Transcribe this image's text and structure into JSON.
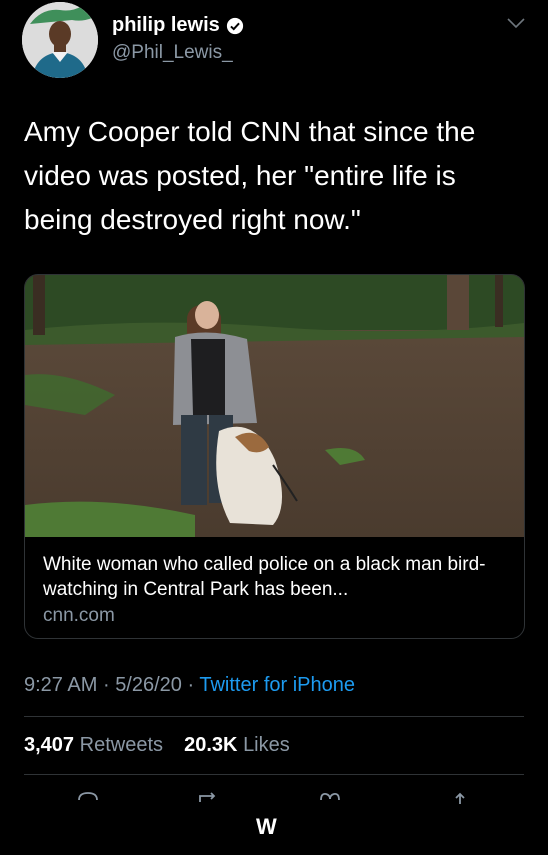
{
  "author": {
    "display_name": "philip lewis",
    "handle": "@Phil_Lewis_"
  },
  "tweet": {
    "text": "Amy Cooper told CNN that since the video was posted, her \"entire life is being destroyed right now.\""
  },
  "link_card": {
    "title": "White woman who called police on a black man bird-watching in Central Park has been...",
    "domain": "cnn.com"
  },
  "meta": {
    "time": "9:27 AM",
    "date": "5/26/20",
    "separator": "·",
    "source": "Twitter for iPhone"
  },
  "stats": {
    "retweets_count": "3,407",
    "retweets_label": "Retweets",
    "likes_count": "20.3K",
    "likes_label": "Likes"
  },
  "watermark": "W",
  "colors": {
    "background": "#000000",
    "text": "#ffffff",
    "secondary": "#8b98a5",
    "link": "#1d9bf0",
    "divider": "#2f3336"
  },
  "icons": [
    "verified-badge-icon",
    "chevron-down-icon",
    "reply-icon",
    "retweet-icon",
    "like-icon",
    "share-icon"
  ]
}
